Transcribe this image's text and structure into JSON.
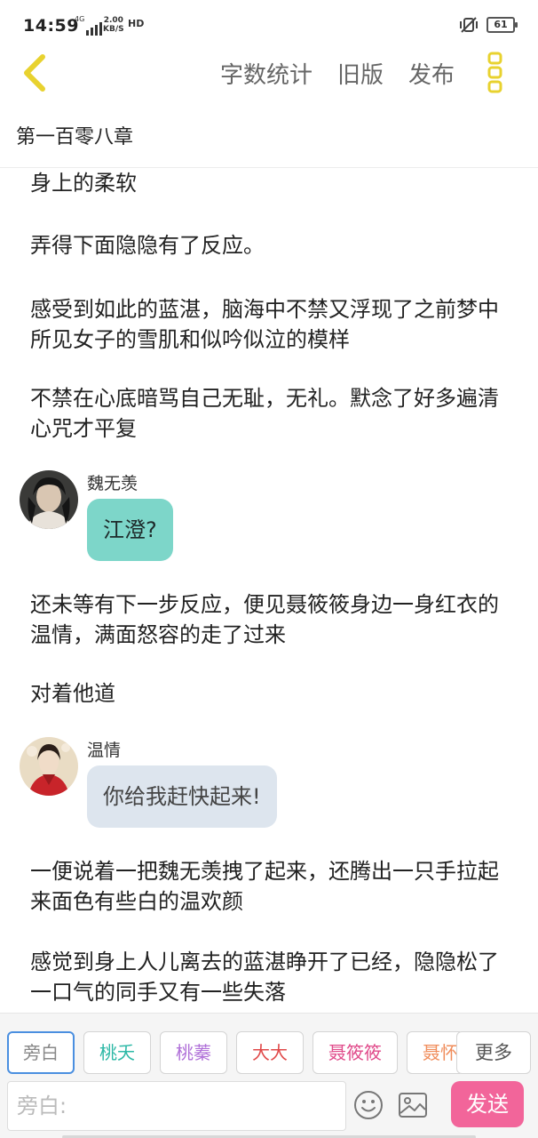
{
  "status_bar": {
    "time": "14:59",
    "network": "4G",
    "speed_value": "2.00",
    "speed_unit": "KB/S",
    "hd_label": "HD",
    "battery": "61"
  },
  "header": {
    "actions": [
      "字数统计",
      "旧版",
      "发布"
    ]
  },
  "chapter_title": "第一百零八章",
  "content": {
    "paragraphs": [
      "身上的柔软",
      "弄得下面隐隐有了反应。",
      "感受到如此的蓝湛，脑海中不禁又浮现了之前梦中所见女子的雪肌和似吟似泣的模样",
      "不禁在心底暗骂自己无耻，无礼。默念了好多遍清心咒才平复",
      "还未等有下一步反应，便见聂筱筱身边一身红衣的温情，满面怒容的走了过来",
      "对着他道",
      "一便说着一把魏无羡拽了起来，还腾出一只手拉起来面色有些白的温欢颜",
      "感觉到身上人儿离去的蓝湛睁开了已经，隐隐松了一口气的同手又有一些失落"
    ],
    "messages": [
      {
        "name": "魏无羡",
        "text": "江澄?",
        "color": "#7dd6c9"
      },
      {
        "name": "温情",
        "text": "你给我赶快起来!",
        "color": "#dde5ee"
      }
    ]
  },
  "toolbar": {
    "roles": [
      {
        "label": "旁白",
        "color": "#888888",
        "active": true
      },
      {
        "label": "桃夭",
        "color": "#2cb8a6"
      },
      {
        "label": "桃蓁",
        "color": "#b070d8"
      },
      {
        "label": "大大",
        "color": "#e04848"
      },
      {
        "label": "聂筱筱",
        "color": "#e04a8a"
      },
      {
        "label": "聂怀",
        "color": "#f08c5a"
      }
    ],
    "more_label": "更多",
    "input_placeholder": "旁白:",
    "send_label": "发送"
  },
  "colors": {
    "accent_yellow": "#e8d22f",
    "send_pink": "#f2659a"
  }
}
